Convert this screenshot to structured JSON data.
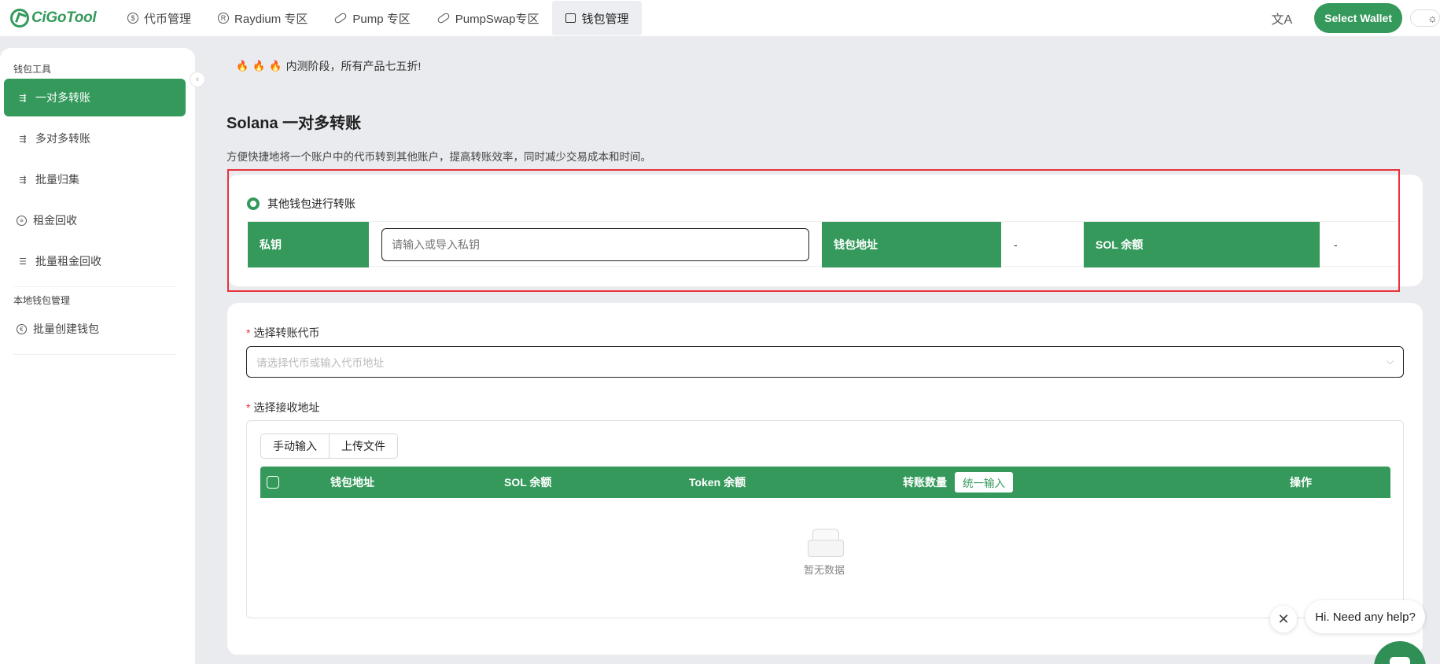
{
  "header": {
    "logo_text": "CiGoTool",
    "nav": [
      {
        "label": "代币管理",
        "icon": "dollar-coin-icon",
        "glyph": "$"
      },
      {
        "label": "Raydium 专区",
        "icon": "raydium-logo-icon",
        "glyph": "R"
      },
      {
        "label": "Pump 专区",
        "icon": "pill-icon",
        "glyph": ""
      },
      {
        "label": "PumpSwap专区",
        "icon": "pill-icon",
        "glyph": ""
      },
      {
        "label": "钱包管理",
        "icon": "wallet-icon",
        "glyph": ""
      }
    ],
    "active_nav": "钱包管理",
    "translate_glyph": "文A",
    "select_wallet_label": "Select Wallet",
    "theme_glyph": "☼"
  },
  "sidebar": {
    "section1_title": "钱包工具",
    "section1_items": [
      {
        "label": "一对多转账",
        "icon": "transfer-icon"
      },
      {
        "label": "多对多转账",
        "icon": "transfer-icon"
      },
      {
        "label": "批量归集",
        "icon": "transfer-icon"
      },
      {
        "label": "租金回收",
        "icon": "coin-icon"
      },
      {
        "label": "批量租金回收",
        "icon": "batch-coin-icon"
      }
    ],
    "active_item": "一对多转账",
    "section2_title": "本地钱包管理",
    "section2_items": [
      {
        "label": "批量创建钱包",
        "icon": "euro-coin-icon",
        "glyph": "€"
      }
    ],
    "collapse_glyph": "‹"
  },
  "main": {
    "notice": "内测阶段，所有产品七五折!",
    "title": "Solana 一对多转账",
    "description": "方便快捷地将一个账户中的代币转到其他账户，提高转账效率，同时减少交易成本和时间。",
    "sender": {
      "radio_label": "其他钱包进行转账",
      "private_key_label": "私钥",
      "private_key_placeholder": "请输入或导入私钥",
      "wallet_address_label": "钱包地址",
      "wallet_address_value": "-",
      "sol_balance_label": "SOL 余额",
      "sol_balance_value": "-"
    },
    "token_field": {
      "label": "选择转账代币",
      "required_mark": "*",
      "placeholder": "请选择代币或输入代币地址",
      "chevron": "⌵"
    },
    "receive_field": {
      "label": "选择接收地址",
      "required_mark": "*",
      "tabs": [
        "手动输入",
        "上传文件"
      ],
      "columns": [
        "钱包地址",
        "SOL 余额",
        "Token 余额",
        "转账数量",
        "操作"
      ],
      "unify_label": "统一输入",
      "empty_text": "暂无数据"
    }
  },
  "help": {
    "close_glyph": "✕",
    "bubble_text": "Hi. Need any help?"
  },
  "colors": {
    "accent": "#34995b",
    "highlight_frame": "#e8333b"
  }
}
